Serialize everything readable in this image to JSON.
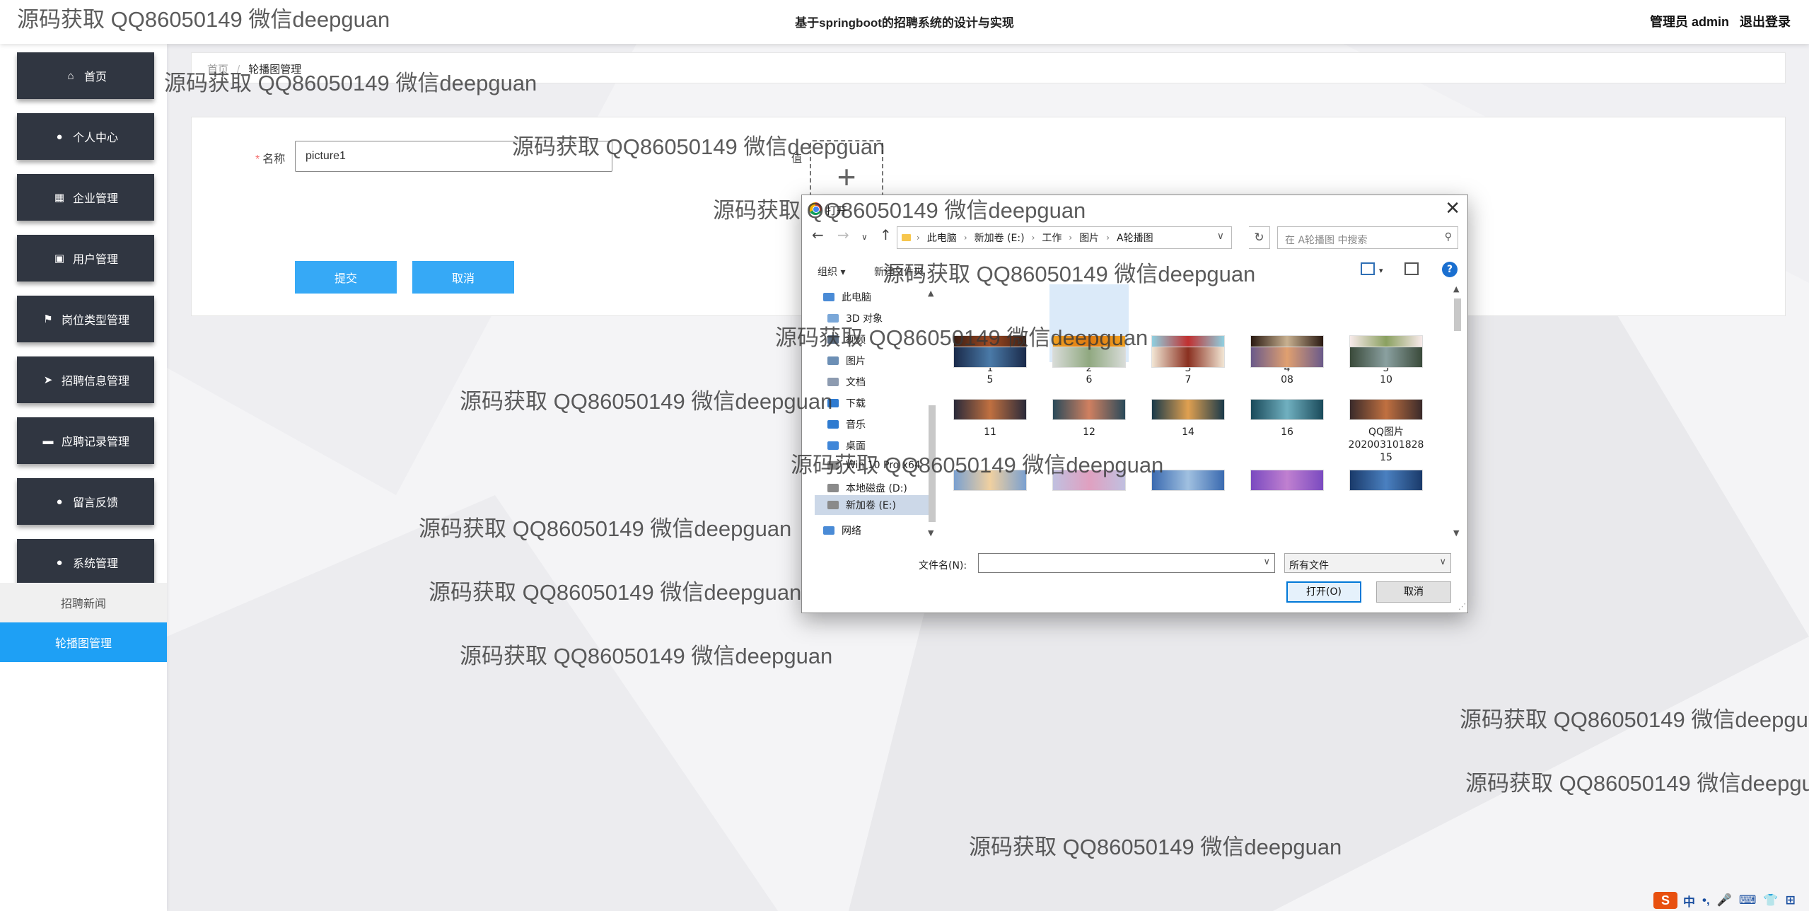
{
  "app": {
    "title": "基于springboot的招聘系统的设计与实现",
    "user_label": "管理员 admin",
    "logout_label": "退出登录"
  },
  "sidebar": {
    "items": [
      {
        "label": "首页",
        "icon": "home-icon"
      },
      {
        "label": "个人中心",
        "icon": "user-icon"
      },
      {
        "label": "企业管理",
        "icon": "grid-icon"
      },
      {
        "label": "用户管理",
        "icon": "clipboard-icon"
      },
      {
        "label": "岗位类型管理",
        "icon": "flag-icon"
      },
      {
        "label": "招聘信息管理",
        "icon": "send-icon"
      },
      {
        "label": "应聘记录管理",
        "icon": "printer-icon"
      },
      {
        "label": "留言反馈",
        "icon": "map-pin-icon"
      },
      {
        "label": "系统管理",
        "icon": "user-icon"
      }
    ],
    "subitems": [
      {
        "label": "招聘新闻",
        "active": false
      },
      {
        "label": "轮播图管理",
        "active": true
      }
    ]
  },
  "breadcrumb": {
    "home": "首页",
    "separator": "/",
    "current": "轮播图管理"
  },
  "form": {
    "name_label": "名称",
    "required_mark": "*",
    "name_value": "picture1",
    "value_label": "值",
    "upload_plus": "+",
    "submit_label": "提交",
    "cancel_label": "取消"
  },
  "dialog": {
    "title": "打开",
    "close": "✕",
    "path": [
      "此电脑",
      "新加卷 (E:)",
      "工作",
      "图片",
      "A轮播图"
    ],
    "search_placeholder": "在 A轮播图 中搜索",
    "organize_label": "组织 ▾",
    "new_folder_label": "新建文件夹",
    "tree": [
      {
        "label": "此电脑",
        "color": "#4a8bd6"
      },
      {
        "label": "3D 对象",
        "color": "#7aa7d8"
      },
      {
        "label": "视频",
        "color": "#5a6b80"
      },
      {
        "label": "图片",
        "color": "#6c8fb5"
      },
      {
        "label": "文档",
        "color": "#8d9bb0"
      },
      {
        "label": "下载",
        "color": "#2f7bd0"
      },
      {
        "label": "音乐",
        "color": "#2f7bd0"
      },
      {
        "label": "桌面",
        "color": "#3f86d8"
      },
      {
        "label": "Win 10 Pro x64",
        "color": "#8a8a8a"
      },
      {
        "label": "本地磁盘 (D:)",
        "color": "#8a8a8a"
      },
      {
        "label": "新加卷 (E:)",
        "color": "#8a8a8a",
        "selected": true
      },
      {
        "label": "网络",
        "color": "#4a8bd6"
      }
    ],
    "files": [
      {
        "name": "1",
        "c1": "#3a1e14",
        "c2": "#a04a22"
      },
      {
        "name": "2",
        "c1": "#f0a020",
        "c2": "#e07a10",
        "selected": true
      },
      {
        "name": "3",
        "c1": "#8fd0e0",
        "c2": "#c03030"
      },
      {
        "name": "4",
        "c1": "#2a1a12",
        "c2": "#c8b090"
      },
      {
        "name": "5",
        "c1": "#f8eaea",
        "c2": "#8aa060"
      },
      {
        "name": "5",
        "c1": "#1a2a4a",
        "c2": "#4a7aa8"
      },
      {
        "name": "6",
        "c1": "#d8dcd8",
        "c2": "#90a880"
      },
      {
        "name": "7",
        "c1": "#f2e6d4",
        "c2": "#8a3020"
      },
      {
        "name": "08",
        "c1": "#6a5a8a",
        "c2": "#e0a070"
      },
      {
        "name": "10",
        "c1": "#3a4a3a",
        "c2": "#8aa0a0"
      },
      {
        "name": "11",
        "c1": "#2a2a3a",
        "c2": "#c07040"
      },
      {
        "name": "12",
        "c1": "#2a4a5a",
        "c2": "#d08060"
      },
      {
        "name": "14",
        "c1": "#1a3a4a",
        "c2": "#e0a050"
      },
      {
        "name": "16",
        "c1": "#1a4a5a",
        "c2": "#70b0c0"
      },
      {
        "name": "QQ图片 202003101828 15",
        "c1": "#3a2a2a",
        "c2": "#c07040"
      },
      {
        "name": "",
        "c1": "#7aa0d0",
        "c2": "#f0d0a0"
      },
      {
        "name": "",
        "c1": "#c0c0e0",
        "c2": "#e0a0c0"
      },
      {
        "name": "",
        "c1": "#3a6ab0",
        "c2": "#a0c0e0"
      },
      {
        "name": "",
        "c1": "#7a4ac0",
        "c2": "#c080d0"
      },
      {
        "name": "",
        "c1": "#1a3a6a",
        "c2": "#4a80c0"
      }
    ],
    "filename_label": "文件名(N):",
    "filename_value": "",
    "filetype_value": "所有文件",
    "open_label": "打开(O)",
    "cancel_label": "取消"
  },
  "watermark": "源码获取 QQ86050149 微信deepguan",
  "ime": {
    "logo": "S",
    "lang": "中",
    "punct": "•,",
    "mic": "🎤",
    "keyboard": "⌨",
    "shirt": "👕",
    "grid": "⊞"
  }
}
